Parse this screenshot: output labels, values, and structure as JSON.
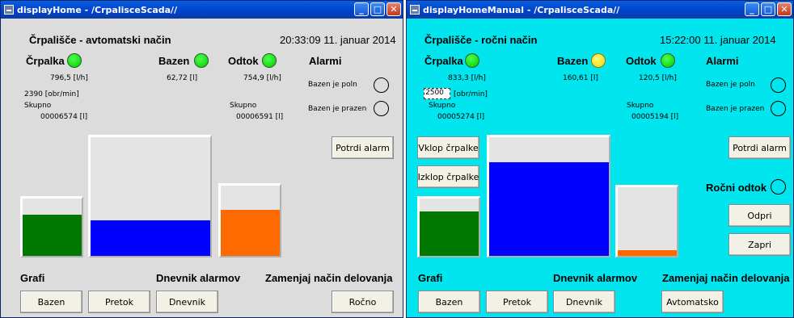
{
  "colors": {
    "left_bg": "#dcdcdc",
    "right_bg": "#00e5ee",
    "titlebar": "#0044cc",
    "led_green": "#00cc00",
    "led_yellow": "#f0d800",
    "tank_green": "#007800",
    "tank_blue": "#0000ff",
    "tank_orange": "#ff6a00"
  },
  "left": {
    "title": "displayHome - /CrpalisceScada//",
    "heading": "Črpališče - avtomatski način",
    "clock": "20:33:09 11. januar 2014",
    "pump": {
      "label": "Črpalka",
      "led": "green",
      "flow": "796,5 [l/h]",
      "rpm": "2390 [obr/min]",
      "total_label": "Skupno",
      "total": "00006574 [l]"
    },
    "pool": {
      "label": "Bazen",
      "led": "green",
      "volume": "62,72 [l]"
    },
    "drain": {
      "label": "Odtok",
      "led": "green",
      "flow": "754,9 [l/h]",
      "total_label": "Skupno",
      "total": "00006591 [l]"
    },
    "alarms": {
      "label": "Alarmi",
      "full": "Bazen je poln",
      "empty": "Bazen je prazen",
      "confirm": "Potrdi alarm"
    },
    "tanks": {
      "pump_level": 0.72,
      "pool_level": 0.3,
      "drain_level": 0.66
    },
    "footer": {
      "graphs_label": "Grafi",
      "log_label": "Dnevnik alarmov",
      "mode_label": "Zamenjaj način delovanja",
      "btn_pool": "Bazen",
      "btn_flow": "Pretok",
      "btn_log": "Dnevnik",
      "btn_mode": "Ročno"
    }
  },
  "right": {
    "title": "displayHomeManual - /CrpalisceScada//",
    "heading": "Črpališče - ročni način",
    "clock": "15:22:00 11. januar 2014",
    "pump": {
      "label": "Črpalka",
      "led": "green",
      "flow": "833,3 [l/h]",
      "rpm_value": "2500",
      "rpm_unit": "[obr/min]",
      "total_label": "Skupno",
      "total": "00005274 [l]"
    },
    "pool": {
      "label": "Bazen",
      "led": "yellow",
      "volume": "160,61 [l]"
    },
    "drain": {
      "label": "Odtok",
      "led": "green",
      "flow": "120,5 [l/h]",
      "total_label": "Skupno",
      "total": "00005194 [l]"
    },
    "alarms": {
      "label": "Alarmi",
      "full": "Bazen je poln",
      "empty": "Bazen je prazen",
      "confirm": "Potrdi alarm"
    },
    "controls": {
      "pump_on": "Vklop črpalke",
      "pump_off": "Izklop črpalke",
      "manual_drain": "Ročni odtok",
      "open": "Odpri",
      "close": "Zapri"
    },
    "tanks": {
      "pump_level": 0.78,
      "pool_level": 0.79,
      "drain_level": 0.08
    },
    "footer": {
      "graphs_label": "Grafi",
      "log_label": "Dnevnik alarmov",
      "mode_label": "Zamenjaj način delovanja",
      "btn_pool": "Bazen",
      "btn_flow": "Pretok",
      "btn_log": "Dnevnik",
      "btn_mode": "Avtomatsko"
    }
  }
}
